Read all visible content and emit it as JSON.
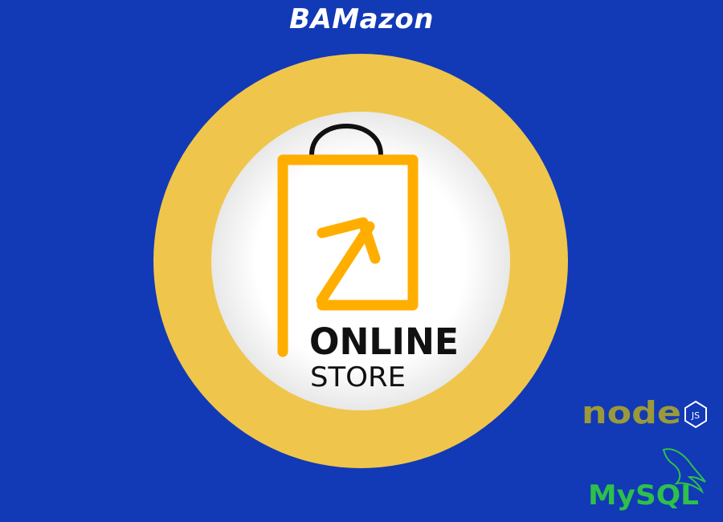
{
  "app": {
    "title": "BAMazon"
  },
  "logo": {
    "line1": "ONLINE",
    "line2": "STORE",
    "icons": [
      "shopping-bag-icon",
      "arrow-up-right-icon"
    ],
    "colors": {
      "ring": "#efc64b",
      "inner": "#ffffff",
      "bag": "#ffae00",
      "handle": "#111111",
      "text": "#111111"
    }
  },
  "tech": {
    "node_text": "node",
    "node_badge": "JS",
    "mysql_text": "MySQL",
    "colors": {
      "node": "#9a9a3a",
      "mysql": "#2ec04b"
    }
  },
  "colors": {
    "background": "#1239b6",
    "title": "#ffffff"
  }
}
